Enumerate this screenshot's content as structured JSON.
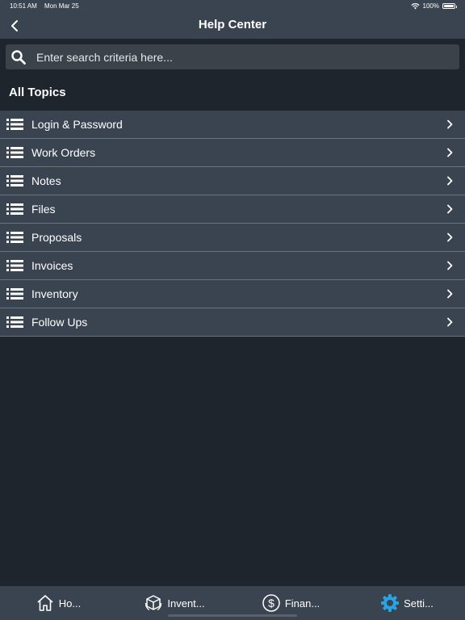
{
  "status_bar": {
    "time": "10:51 AM",
    "date": "Mon Mar 25",
    "battery": "100%",
    "wifi_icon": "wifi-icon",
    "battery_icon": "battery-icon"
  },
  "nav": {
    "title": "Help Center",
    "back_icon": "chevron-left-icon"
  },
  "search": {
    "placeholder": "Enter search criteria here...",
    "value": "",
    "icon": "search-icon"
  },
  "section": {
    "title": "All Topics"
  },
  "topics": [
    {
      "label": "Login & Password"
    },
    {
      "label": "Work Orders"
    },
    {
      "label": "Notes"
    },
    {
      "label": "Files"
    },
    {
      "label": "Proposals"
    },
    {
      "label": "Invoices"
    },
    {
      "label": "Inventory"
    },
    {
      "label": "Follow Ups"
    }
  ],
  "tabs": [
    {
      "label": "Ho...",
      "icon": "home-icon"
    },
    {
      "label": "Invent...",
      "icon": "inventory-box-icon"
    },
    {
      "label": "Finan...",
      "icon": "dollar-circle-icon"
    },
    {
      "label": "Setti...",
      "icon": "gear-icon",
      "active": true
    }
  ],
  "colors": {
    "background": "#1e252d",
    "bar": "#3a4350",
    "search_field": "#3b424a",
    "divider": "#6b737d",
    "active_tab_icon": "#2aa3e0"
  }
}
